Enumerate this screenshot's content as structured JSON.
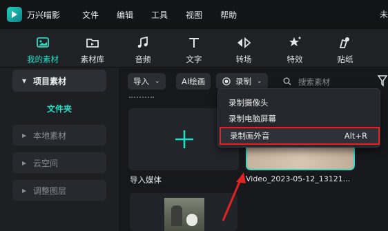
{
  "app": {
    "name": "万兴喵影"
  },
  "menu": [
    "文件",
    "编辑",
    "工具",
    "视图",
    "帮助"
  ],
  "title_right": "未",
  "toolbar": [
    {
      "label": "我的素材",
      "icon": "my-media-icon",
      "active": true
    },
    {
      "label": "素材库",
      "icon": "stock-media-icon"
    },
    {
      "label": "音频",
      "icon": "music-note-icon"
    },
    {
      "label": "文字",
      "icon": "text-icon"
    },
    {
      "label": "转场",
      "icon": "transition-icon"
    },
    {
      "label": "特效",
      "icon": "effects-icon"
    },
    {
      "label": "贴纸",
      "icon": "sticker-icon"
    }
  ],
  "sidebar": {
    "project_media": "项目素材",
    "folder": "文件夹",
    "items": [
      "本地素材",
      "云空间",
      "调整图层"
    ]
  },
  "media_toolbar": {
    "import": "导入",
    "ai_draw": "AI绘画",
    "record": "录制",
    "search_placeholder": "搜索素材"
  },
  "media": {
    "import_label": "导入媒体",
    "video_label": "Video_2023-05-12_13121..."
  },
  "record_menu": {
    "items": [
      {
        "label": "录制摄像头",
        "shortcut": ""
      },
      {
        "label": "录制电脑屏幕",
        "shortcut": ""
      },
      {
        "label": "录制画外音",
        "shortcut": "Alt+R"
      }
    ]
  },
  "colors": {
    "accent": "#1fe0c4",
    "highlight": "#e22323"
  }
}
